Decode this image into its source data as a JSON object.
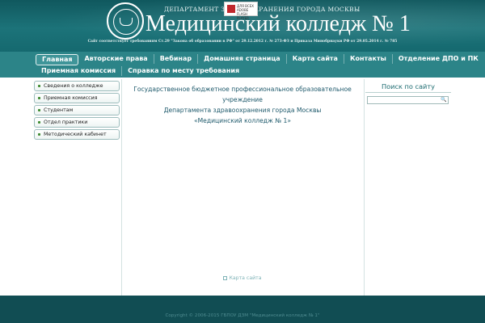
{
  "header": {
    "department": "ДЕПАРТАМЕНТ ЗДРАВООХРАНЕНИЯ ГОРОДА МОСКВЫ",
    "title": "Медицинский колледж № 1",
    "law_notice": "Сайт соответствует требованиям Ст.29 \"Закона об образовании в РФ\" от 29.12.2012 г. № 273-ФЗ и Приказа Минобрнауки РФ от 29.05.2014 г. № 785",
    "badge_text": [
      "ДЛЯ ВСЕХ",
      "ADOBE",
      "FLASH PLAYER"
    ]
  },
  "nav": {
    "row1": [
      "Главная",
      "Авторские права",
      "Вебинар",
      "Домашняя страница",
      "Карта сайта",
      "Контакты",
      "Отделение ДПО и ПК"
    ],
    "row2": [
      "Приемная комиссия",
      "Справка по месту требования"
    ],
    "active": "Главная"
  },
  "sidebar": {
    "items": [
      {
        "label": "Сведения о колледже"
      },
      {
        "label": "Приемная комиссия"
      },
      {
        "label": "Студентам"
      },
      {
        "label": "Отдел практики"
      },
      {
        "label": "Методический кабинет"
      }
    ]
  },
  "main": {
    "lines": [
      "Государственное бюджетное профессиональное образовательное учреждение",
      "Департамента здравоохранения города Москвы",
      "«Медицинский колледж № 1»"
    ]
  },
  "search": {
    "title": "Поиск по сайту",
    "value": "",
    "button_icon": "search-icon"
  },
  "footer": {
    "sitemap": "Карта сайта",
    "copyright": "Copyright © 2006-2015 ГБПОУ ДЗМ \"Медицинский колледж № 1\""
  },
  "colors": {
    "header_bg": "#1c7379",
    "nav_bg": "#2c8488",
    "footer_bg": "#114d53",
    "text_main": "#1f5a6c"
  }
}
